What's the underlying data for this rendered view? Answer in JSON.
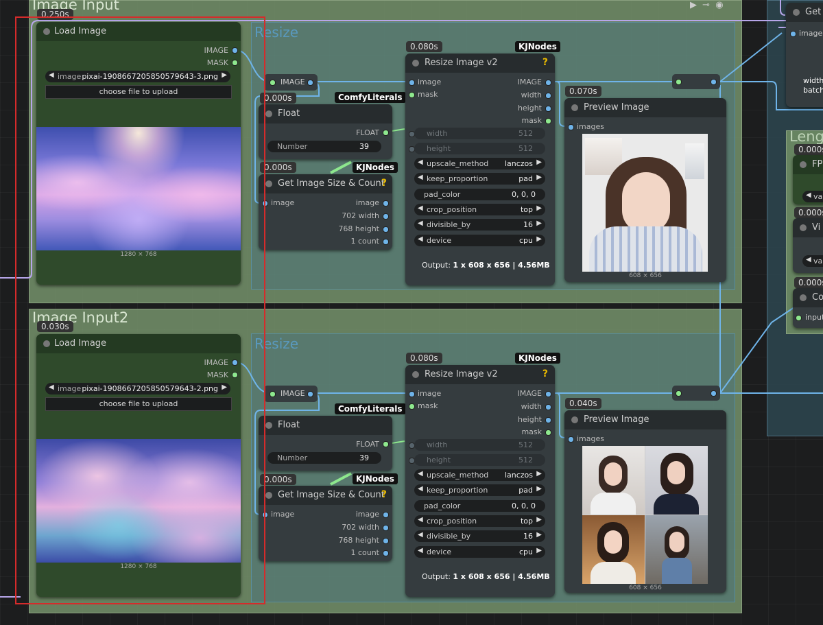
{
  "groups": {
    "image_input": {
      "title": "Image Input"
    },
    "image_input2": {
      "title": "Image Input2"
    },
    "resize1": {
      "title": "Resize"
    },
    "resize2": {
      "title": "Resize"
    },
    "lengths": {
      "title": "Leng"
    }
  },
  "nodes": {
    "load1": {
      "timing": "0.250s",
      "title": "Load Image",
      "out_image": "IMAGE",
      "out_mask": "MASK",
      "widget_label": "image",
      "filename": "pixai-1908667205850579643-3.png",
      "upload": "choose file to upload",
      "caption": "1280 × 768"
    },
    "load2": {
      "timing": "0.030s",
      "title": "Load Image",
      "out_image": "IMAGE",
      "out_mask": "MASK",
      "widget_label": "image",
      "filename": "pixai-1908667205850579643-2.png",
      "upload": "choose file to upload",
      "caption": "1280 × 768"
    },
    "reroute_image": "IMAGE",
    "float1": {
      "timing": "0.000s",
      "badge": "ComfyLiterals",
      "title": "Float",
      "out": "FLOAT",
      "widget_label": "Number",
      "value": "39"
    },
    "float2": {
      "badge": "ComfyLiterals",
      "title": "Float",
      "out": "FLOAT",
      "widget_label": "Number",
      "value": "39"
    },
    "size1": {
      "timing": "0.000s",
      "badge": "KJNodes",
      "title": "Get Image Size & Count",
      "in": "image",
      "o1": "image",
      "o2": "702 width",
      "o3": "768 height",
      "o4": "1 count"
    },
    "size2": {
      "timing": "0.000s",
      "badge": "KJNodes",
      "title": "Get Image Size & Count",
      "in": "image",
      "o1": "image",
      "o2": "702 width",
      "o3": "768 height",
      "o4": "1 count"
    },
    "resize1": {
      "timing": "0.080s",
      "badge": "KJNodes",
      "title": "Resize Image v2",
      "in_image": "image",
      "in_mask": "mask",
      "out_image": "IMAGE",
      "out_width": "width",
      "out_height": "height",
      "out_mask": "mask",
      "w_width": [
        "width",
        "512"
      ],
      "w_height": [
        "height",
        "512"
      ],
      "w_upscale": [
        "upscale_method",
        "lanczos"
      ],
      "w_keep": [
        "keep_proportion",
        "pad"
      ],
      "w_padcolor": [
        "pad_color",
        "0, 0, 0"
      ],
      "w_crop": [
        "crop_position",
        "top"
      ],
      "w_div": [
        "divisible_by",
        "16"
      ],
      "w_device": [
        "device",
        "cpu"
      ],
      "output_prefix": "Output:",
      "output_value": "1 x 608 x 656 | 4.56MB"
    },
    "resize2": {
      "timing": "0.080s",
      "badge": "KJNodes",
      "title": "Resize Image v2",
      "in_image": "image",
      "in_mask": "mask",
      "out_image": "IMAGE",
      "out_width": "width",
      "out_height": "height",
      "out_mask": "mask",
      "w_width": [
        "width",
        "512"
      ],
      "w_height": [
        "height",
        "512"
      ],
      "w_upscale": [
        "upscale_method",
        "lanczos"
      ],
      "w_keep": [
        "keep_proportion",
        "pad"
      ],
      "w_padcolor": [
        "pad_color",
        "0, 0, 0"
      ],
      "w_crop": [
        "crop_position",
        "top"
      ],
      "w_div": [
        "divisible_by",
        "16"
      ],
      "w_device": [
        "device",
        "cpu"
      ],
      "output_prefix": "Output:",
      "output_value": "1 x 608 x 656 | 4.56MB"
    },
    "preview1": {
      "timing": "0.070s",
      "title": "Preview Image",
      "in": "images",
      "caption": "608 × 656"
    },
    "preview2": {
      "timing": "0.040s",
      "title": "Preview Image",
      "in": "images",
      "caption": "608 × 656"
    },
    "right_get": {
      "title": "Get",
      "in": "image",
      "l1": "width:",
      "l2": "batch"
    },
    "right_fp": {
      "timing": "0.000s",
      "title": "FP",
      "widget": "va"
    },
    "right_vi": {
      "timing": "0.000s",
      "title": "Vi",
      "widget": "va"
    },
    "right_co": {
      "timing": "0.000s",
      "title": "Co",
      "in": "input"
    }
  },
  "colors": {
    "selection": "#d52b2b",
    "wire_image": "#6fb4e9",
    "wire_float": "#8ee88e",
    "wire_purple": "#b7a6ea"
  }
}
